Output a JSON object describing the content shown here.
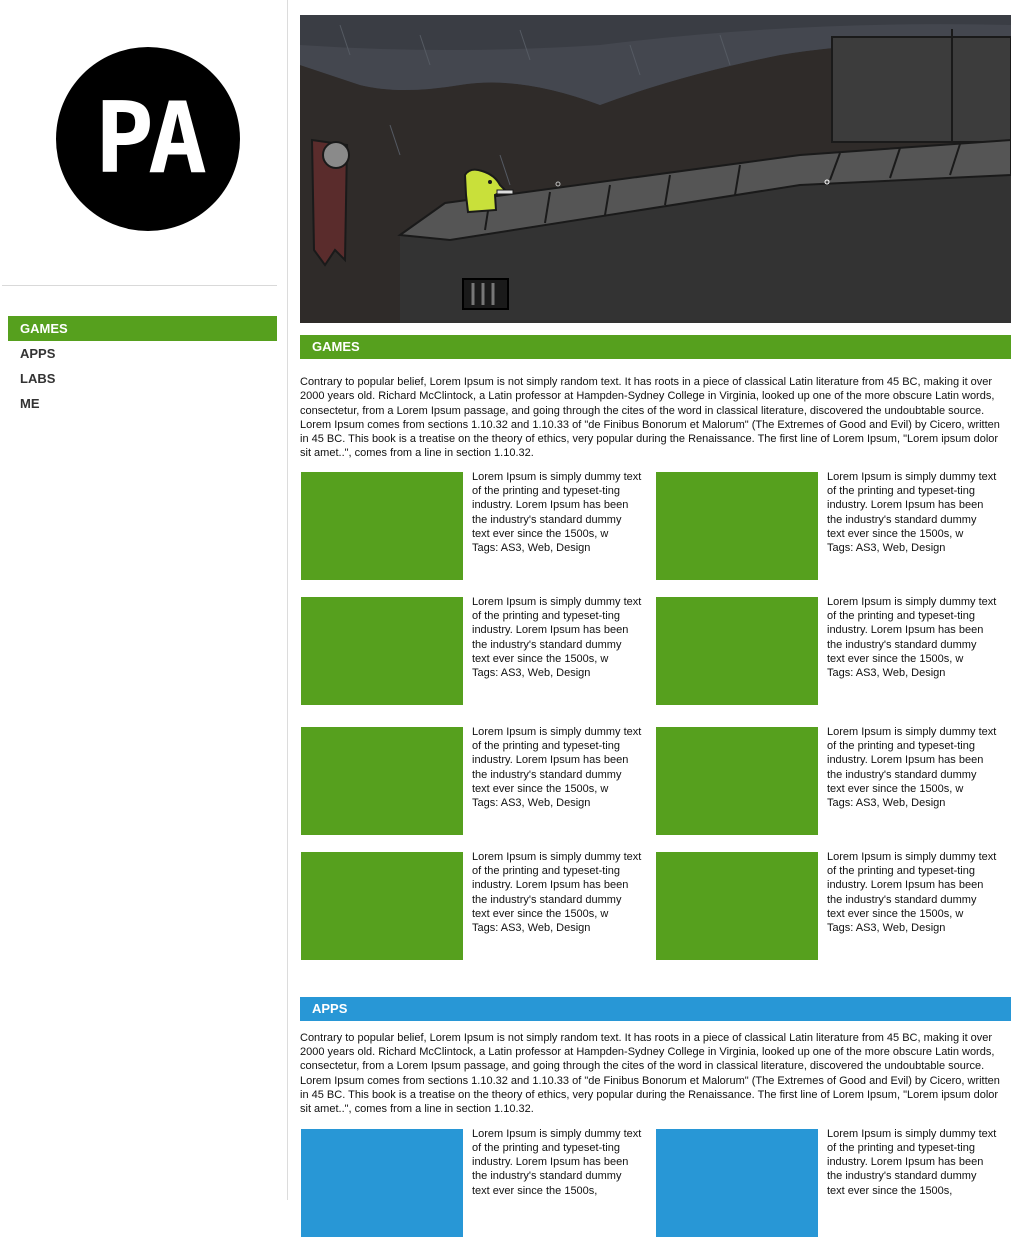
{
  "logo": {
    "text": "PA"
  },
  "nav": {
    "items": [
      {
        "label": "GAMES",
        "active": true
      },
      {
        "label": "APPS",
        "active": false
      },
      {
        "label": "LABS",
        "active": false
      },
      {
        "label": "ME",
        "active": false
      }
    ]
  },
  "sections": {
    "games": {
      "title": "GAMES",
      "color": "#56a01e",
      "intro": "Contrary to popular belief, Lorem Ipsum is not simply random text. It has roots in a piece of classical Latin literature from 45 BC, making it over 2000 years old. Richard McClintock, a Latin professor at Hampden-Sydney College in Virginia, looked up one of the more obscure Latin words, consectetur, from a Lorem Ipsum passage, and going through the cites of the word in classical literature, discovered the undoubtable source. Lorem Ipsum comes from sections 1.10.32 and 1.10.33 of \"de Finibus Bonorum et Malorum\" (The Extremes of Good and Evil) by Cicero, written in 45 BC. This book is a treatise on the theory of ethics, very popular during the Renaissance. The first line of Lorem Ipsum, \"Lorem ipsum dolor sit amet..\", comes from a line in section 1.10.32.",
      "cards": [
        {
          "text": "Lorem Ipsum is simply dummy text of the printing and typeset-ting industry. Lorem Ipsum has been the industry's standard dummy text ever since the 1500s, w",
          "tags": "Tags: AS3, Web, Design"
        },
        {
          "text": "Lorem Ipsum is simply dummy text of the printing and typeset-ting industry. Lorem Ipsum has been the industry's standard dummy text ever since the 1500s, w",
          "tags": "Tags: AS3, Web, Design"
        },
        {
          "text": "Lorem Ipsum is simply dummy text of the printing and typeset-ting industry. Lorem Ipsum has been the industry's standard dummy text ever since the 1500s, w",
          "tags": "Tags: AS3, Web, Design"
        },
        {
          "text": "Lorem Ipsum is simply dummy text of the printing and typeset-ting industry. Lorem Ipsum has been the industry's standard dummy text ever since the 1500s, w",
          "tags": "Tags: AS3, Web, Design"
        },
        {
          "text": "Lorem Ipsum is simply dummy text of the printing and typeset-ting industry. Lorem Ipsum has been the industry's standard dummy text ever since the 1500s, w",
          "tags": "Tags: AS3, Web, Design"
        },
        {
          "text": "Lorem Ipsum is simply dummy text of the printing and typeset-ting industry. Lorem Ipsum has been the industry's standard dummy text ever since the 1500s, w",
          "tags": "Tags: AS3, Web, Design"
        },
        {
          "text": "Lorem Ipsum is simply dummy text of the printing and typeset-ting industry. Lorem Ipsum has been the industry's standard dummy text ever since the 1500s, w",
          "tags": "Tags: AS3, Web, Design"
        },
        {
          "text": "Lorem Ipsum is simply dummy text of the printing and typeset-ting industry. Lorem Ipsum has been the industry's standard dummy text ever since the 1500s, w",
          "tags": "Tags: AS3, Web, Design"
        }
      ]
    },
    "apps": {
      "title": "APPS",
      "color": "#2897d6",
      "intro": "Contrary to popular belief, Lorem Ipsum is not simply random text. It has roots in a piece of classical Latin literature from 45 BC, making it over 2000 years old. Richard McClintock, a Latin professor at Hampden-Sydney College in Virginia, looked up one of the more obscure Latin words, consectetur, from a Lorem Ipsum passage, and going through the cites of the word in classical literature, discovered the undoubtable source. Lorem Ipsum comes from sections 1.10.32 and 1.10.33 of \"de Finibus Bonorum et Malorum\" (The Extremes of Good and Evil) by Cicero, written in 45 BC. This book is a treatise on the theory of ethics, very popular during the Renaissance. The first line of Lorem Ipsum, \"Lorem ipsum dolor sit amet..\", comes from a line in section 1.10.32.",
      "cards": [
        {
          "text": "Lorem Ipsum is simply dummy text of the printing and typeset-ting industry. Lorem Ipsum has been the industry's standard dummy text ever since the 1500s,",
          "tags": ""
        },
        {
          "text": "Lorem Ipsum is simply dummy text of the printing and typeset-ting industry. Lorem Ipsum has been the industry's standard dummy text ever since the 1500s,",
          "tags": ""
        }
      ]
    }
  }
}
